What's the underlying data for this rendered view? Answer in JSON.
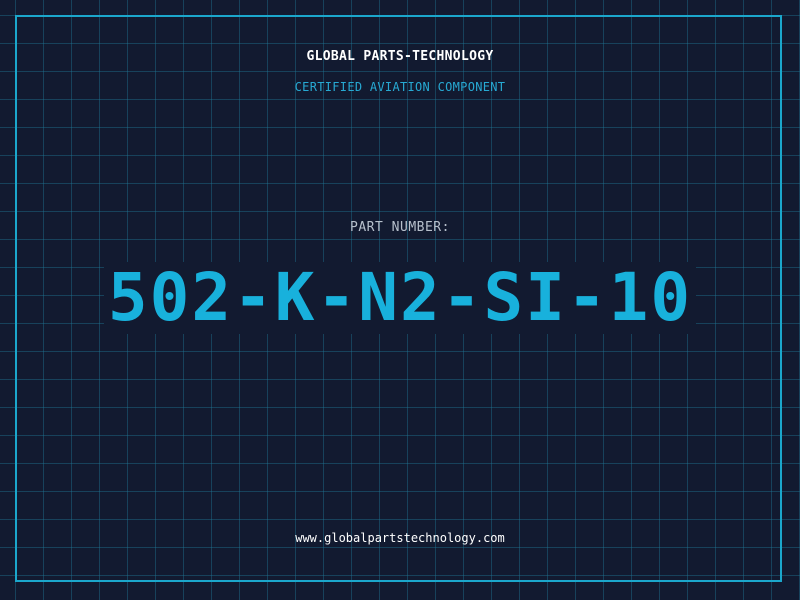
{
  "header": {
    "company": "GLOBAL PARTS-TECHNOLOGY",
    "tagline": "CERTIFIED AVIATION COMPONENT"
  },
  "part": {
    "label": "PART NUMBER:",
    "number": "502-K-N2-SI-10"
  },
  "footer": {
    "url": "www.globalpartstechnology.com"
  },
  "colors": {
    "background": "#121a30",
    "accent": "#18b1dc",
    "grid": "#1e5f78",
    "text": "#ffffff"
  }
}
